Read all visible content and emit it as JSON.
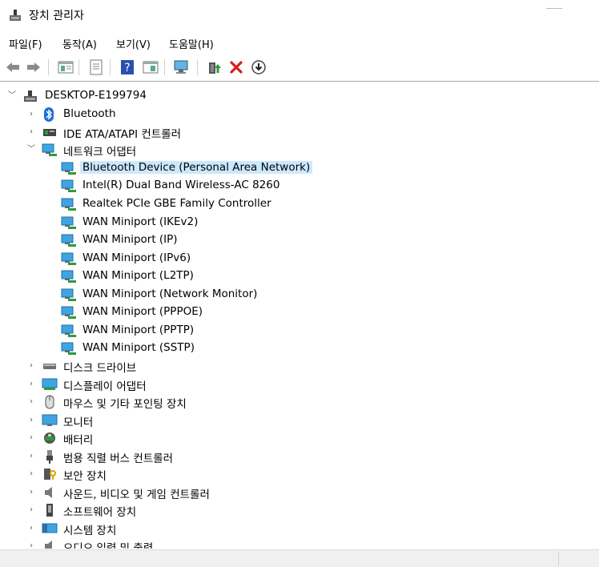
{
  "window": {
    "title": "장치 관리자"
  },
  "menu": [
    "파일(F)",
    "동작(A)",
    "보기(V)",
    "도움말(H)"
  ],
  "toolbar_icons": [
    "back-arrow-icon",
    "forward-arrow-icon",
    "properties-grid-icon",
    "document-icon",
    "help-icon",
    "view-panel-icon",
    "monitor-scan-icon",
    "update-driver-icon",
    "uninstall-x-icon",
    "download-circle-icon"
  ],
  "tree": {
    "root": "DESKTOP-E199794",
    "items": [
      {
        "label": "Bluetooth",
        "icon": "bluetooth-icon",
        "level": 1,
        "expanded": false
      },
      {
        "label": "IDE ATA/ATAPI 컨트롤러",
        "icon": "ide-controller-icon",
        "level": 1,
        "expanded": false
      },
      {
        "label": "네트워크 어댑터",
        "icon": "network-adapter-icon",
        "level": 1,
        "expanded": true
      },
      {
        "label": "Bluetooth Device (Personal Area Network)",
        "icon": "network-adapter-icon",
        "level": 2,
        "selected": true
      },
      {
        "label": "Intel(R) Dual Band Wireless-AC 8260",
        "icon": "network-adapter-icon",
        "level": 2
      },
      {
        "label": "Realtek PCIe GBE Family Controller",
        "icon": "network-adapter-icon",
        "level": 2
      },
      {
        "label": "WAN Miniport (IKEv2)",
        "icon": "network-adapter-icon",
        "level": 2
      },
      {
        "label": "WAN Miniport (IP)",
        "icon": "network-adapter-icon",
        "level": 2
      },
      {
        "label": "WAN Miniport (IPv6)",
        "icon": "network-adapter-icon",
        "level": 2
      },
      {
        "label": "WAN Miniport (L2TP)",
        "icon": "network-adapter-icon",
        "level": 2
      },
      {
        "label": "WAN Miniport (Network Monitor)",
        "icon": "network-adapter-icon",
        "level": 2
      },
      {
        "label": "WAN Miniport (PPPOE)",
        "icon": "network-adapter-icon",
        "level": 2
      },
      {
        "label": "WAN Miniport (PPTP)",
        "icon": "network-adapter-icon",
        "level": 2
      },
      {
        "label": "WAN Miniport (SSTP)",
        "icon": "network-adapter-icon",
        "level": 2
      },
      {
        "label": "디스크 드라이브",
        "icon": "disk-drive-icon",
        "level": 1,
        "expanded": false
      },
      {
        "label": "디스플레이 어댑터",
        "icon": "display-adapter-icon",
        "level": 1,
        "expanded": false
      },
      {
        "label": "마우스 및 기타 포인팅 장치",
        "icon": "mouse-icon",
        "level": 1,
        "expanded": false
      },
      {
        "label": "모니터",
        "icon": "monitor-icon",
        "level": 1,
        "expanded": false
      },
      {
        "label": "배터리",
        "icon": "battery-icon",
        "level": 1,
        "expanded": false
      },
      {
        "label": "범용 직렬 버스 컨트롤러",
        "icon": "usb-icon",
        "level": 1,
        "expanded": false
      },
      {
        "label": "보안 장치",
        "icon": "security-device-icon",
        "level": 1,
        "expanded": false
      },
      {
        "label": "사운드, 비디오 및 게임 컨트롤러",
        "icon": "speaker-icon",
        "level": 1,
        "expanded": false
      },
      {
        "label": "소프트웨어 장치",
        "icon": "software-device-icon",
        "level": 1,
        "expanded": false
      },
      {
        "label": "시스템 장치",
        "icon": "system-device-icon",
        "level": 1,
        "expanded": false
      },
      {
        "label": "오디오 입력 및 출력",
        "icon": "audio-io-icon",
        "level": 1,
        "expanded": false
      }
    ]
  }
}
